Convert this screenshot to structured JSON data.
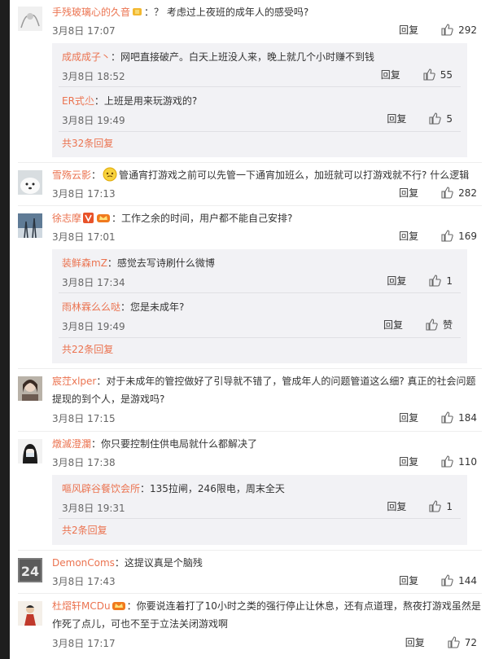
{
  "comments": [
    {
      "user": "手残玻璃心的久音",
      "text": "：？ 考虑过上夜班的成年人的感受吗?",
      "date": "3月8日 17:07",
      "reply": "回复",
      "likes": "292",
      "replies": [
        {
          "user": "成成成子丶",
          "text": "：网吧直接破产。白天上班没人来，晚上就几个小时赚不到钱",
          "date": "3月8日 18:52",
          "reply": "回复",
          "likes": "55"
        },
        {
          "user": "ER式尐",
          "text": "：上班是用来玩游戏的?",
          "date": "3月8日 19:49",
          "reply": "回复",
          "likes": "5"
        }
      ],
      "more": "共32条回复"
    },
    {
      "user": "雪殇云影",
      "text": "管通宵打游戏之前可以先管一下通宵加班么，加班就可以打游戏就不行? 什么逻辑",
      "date": "3月8日 17:13",
      "reply": "回复",
      "likes": "282"
    },
    {
      "user": "徐志摩",
      "text": "：工作之余的时间，用户都不能自己安排?",
      "date": "3月8日 17:01",
      "reply": "回复",
      "likes": "169",
      "replies": [
        {
          "user": "装鲜森mZ",
          "text": "：感觉去写诗刷什么微博",
          "date": "3月8日 17:34",
          "reply": "回复",
          "likes": "1"
        },
        {
          "user": "雨林霖么么哒",
          "text": "：您是未成年?",
          "date": "3月8日 19:49",
          "reply": "回复",
          "likes": "赞"
        }
      ],
      "more": "共22条回复"
    },
    {
      "user": "宸茳xlper",
      "text": "：对于未成年的管控做好了引导就不错了，管成年人的问题管道这么细? 真正的社会问题提现的到个人，是游戏吗?",
      "date": "3月8日 17:15",
      "reply": "回复",
      "likes": "184"
    },
    {
      "user": "燉滅澄瀾",
      "text": "：你只要控制住供电局就什么都解决了",
      "date": "3月8日 17:38",
      "reply": "回复",
      "likes": "110",
      "replies": [
        {
          "user": "嘔风辟谷餐饮会所",
          "text": "：135拉闸，246限电，周末全天",
          "date": "3月8日 19:31",
          "reply": "回复",
          "likes": "1"
        }
      ],
      "more": "共2条回复"
    },
    {
      "user": "DemonComs",
      "text": "：这提议真是个脑残",
      "date": "3月8日 17:43",
      "reply": "回复",
      "likes": "144"
    },
    {
      "user": "杜熠轩MCDu",
      "text": "：你要说连着打了10小时之类的强行停止让休息，还有点道理，熬夜打游戏虽然是作死了点儿，可也不至于立法关闭游戏啊",
      "date": "3月8日 17:17",
      "reply": "回复",
      "likes": "72"
    }
  ],
  "avatar_text": {
    "demoncoms": "24"
  },
  "colors": {
    "username": "#eb7350",
    "reply_bg": "#f2f2f5",
    "page_bg": "#1e1e1e"
  }
}
